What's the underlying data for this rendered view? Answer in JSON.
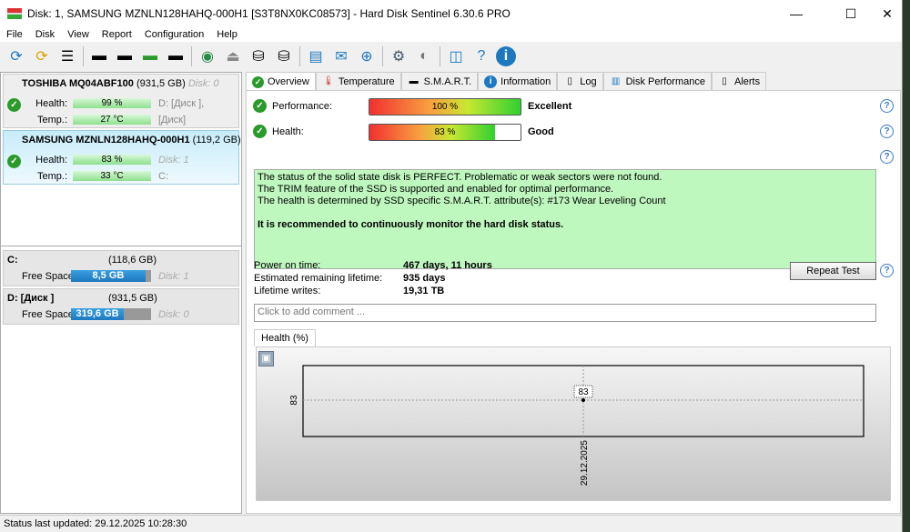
{
  "window": {
    "title": "Disk: 1, SAMSUNG MZNLN128HAHQ-000H1 [S3T8NX0KC08573]  -  Hard Disk Sentinel 6.30.6 PRO"
  },
  "menu": [
    "File",
    "Disk",
    "View",
    "Report",
    "Configuration",
    "Help"
  ],
  "disks": [
    {
      "name": "TOSHIBA MQ04ABF100",
      "size": "(931,5 GB)",
      "disk": "Disk: 0",
      "health_label": "Health:",
      "health": "99 %",
      "temp_label": "Temp.:",
      "temp": "27 °C",
      "ext1": "D: [Диск ],",
      "ext2": "[Диск]"
    },
    {
      "name": "SAMSUNG MZNLN128HAHQ-000H1",
      "size": "(119,2 GB)",
      "health_label": "Health:",
      "health": "83 %",
      "temp_label": "Temp.:",
      "temp": "33 °C",
      "ext1": "Disk: 1",
      "ext2": "C:"
    }
  ],
  "partitions": [
    {
      "name": "C:",
      "size": "(118,6 GB)",
      "free_label": "Free Space",
      "free": "8,5 GB",
      "free_fraction": 0.93,
      "disk": "Disk: 1"
    },
    {
      "name": "D: [Диск ]",
      "size": "(931,5 GB)",
      "free_label": "Free Space",
      "free": "319,6 GB",
      "free_fraction": 0.66,
      "disk": "Disk: 0"
    }
  ],
  "tabs": [
    "Overview",
    "Temperature",
    "S.M.A.R.T.",
    "Information",
    "Log",
    "Disk Performance",
    "Alerts"
  ],
  "overview": {
    "performance_label": "Performance:",
    "performance": "100 %",
    "performance_value": 100,
    "performance_rating": "Excellent",
    "health_label": "Health:",
    "health": "83 %",
    "health_value": 83,
    "health_rating": "Good",
    "status_lines": [
      "The status of the solid state disk is PERFECT. Problematic or weak sectors were not found.",
      "The TRIM feature of the SSD is supported and enabled for optimal performance.",
      "The health is determined by SSD specific S.M.A.R.T. attribute(s):  #173 Wear Leveling Count"
    ],
    "recommendation": "It is recommended to continuously monitor the hard disk status.",
    "power_on_label": "Power on time:",
    "power_on": "467 days, 11 hours",
    "remaining_label": "Estimated remaining lifetime:",
    "remaining": "935 days",
    "writes_label": "Lifetime writes:",
    "writes": "19,31 TB",
    "repeat_test": "Repeat Test",
    "comment_placeholder": "Click to add comment ..."
  },
  "chart_tab": "Health (%)",
  "chart_data": {
    "type": "line",
    "title": "Health (%)",
    "x": [
      "29.12.2025"
    ],
    "values": [
      83
    ],
    "ytick": "83",
    "point_label": "83"
  },
  "statusbar": "Status last updated: 29.12.2025 10:28:30"
}
